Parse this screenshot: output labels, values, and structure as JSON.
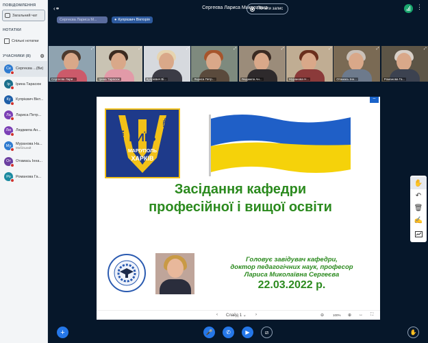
{
  "sidebar": {
    "messages_title": "ПОВІДОМЛЕННЯ",
    "public_chat": "Загальний чат",
    "notes_title": "НОТАТКИ",
    "shared_notes": "Спільні нотатки",
    "users_title": "УЧАСНИКИ (8)",
    "users": [
      {
        "initials": "Се",
        "name": "Сергеєва ...(Ви)",
        "color": "#2f7bd0",
        "active": true,
        "sub": ""
      },
      {
        "initials": "Ір",
        "name": "Ірина Тарасюк",
        "color": "#1b6f8c",
        "active": false,
        "sub": ""
      },
      {
        "initials": "Ку",
        "name": "Купрієвич Вікт...",
        "color": "#1f5fa8",
        "active": false,
        "sub": ""
      },
      {
        "initials": "Ла",
        "name": "Лариса Петр...",
        "color": "#7b3fb5",
        "active": false,
        "sub": ""
      },
      {
        "initials": "Лю",
        "name": "Людмила Ан...",
        "color": "#7b3fb5",
        "active": false,
        "sub": ""
      },
      {
        "initials": "Му",
        "name": "Муранова На...",
        "color": "#2f7bd0",
        "active": false,
        "sub": "Мобільний"
      },
      {
        "initials": "От",
        "name": "Отамась Інна...",
        "color": "#6b3fa0",
        "active": false,
        "sub": ""
      },
      {
        "initials": "Ро",
        "name": "Романова Га...",
        "color": "#1b8aa0",
        "active": false,
        "sub": ""
      }
    ]
  },
  "topbar": {
    "meeting_title": "Сергеєва Лариса Миколаївна",
    "record_label": "Почати запис"
  },
  "presenters": {
    "first": "Сергеєва Лариса М...",
    "second": "Купрієвич Вікторія"
  },
  "videos": [
    {
      "label": "Сергеєва Лари...",
      "hair": "#4d3a2e",
      "body": "#cc5a6a",
      "bg": "#8fa3b0"
    },
    {
      "label": "Ірина Тарасюк",
      "hair": "#3b2a20",
      "body": "#e29aa8",
      "bg": "#c9c3b3"
    },
    {
      "label": "Купрієвич Ві...",
      "hair": "#e6d4b0",
      "body": "#3c3c46",
      "bg": "#d6d9de"
    },
    {
      "label": "Лариса Петр...",
      "hair": "#a6552c",
      "body": "#5a4a3c",
      "bg": "#7e8a7e"
    },
    {
      "label": "Людмила Ан...",
      "hair": "#3a2a22",
      "body": "#2e2a2c",
      "bg": "#9b8c7a"
    },
    {
      "label": "Муранова Н...",
      "hair": "#6a2e1c",
      "body": "#8b3a3a",
      "bg": "#c0ad93"
    },
    {
      "label": "Отамась Інн...",
      "hair": "#c9c0b8",
      "body": "#6d7a8c",
      "bg": "#7a6a54"
    },
    {
      "label": "Романова Га...",
      "hair": "#d8d0c8",
      "body": "#3c4250",
      "bg": "#5d5546"
    }
  ],
  "slide": {
    "logo_top_left": "ЧЕРНІГІВ",
    "logo_center": "КИЇВ",
    "logo_left": "МИКОЛАЇВ",
    "logo_bottom": "МАРІУПОЛЬ",
    "logo_bottom2": "ХАРКІВ",
    "title_line1": "Засідання кафедри",
    "title_line2": "професійної і вищої освіти",
    "info_line1": "Головує завідувач кафедри,",
    "info_line2": "доктор педагогічних наук, професор",
    "info_line3": "Лариса Миколаївна Сергеєва",
    "info_date": "22.03.2022 р.",
    "nav_label": "Слайд 1",
    "zoom": "100%"
  },
  "colors": {
    "accent": "#1a63c9",
    "title_green": "#2b8a1e",
    "flag_blue": "#1f5fc7",
    "flag_yellow": "#f5d20a"
  }
}
